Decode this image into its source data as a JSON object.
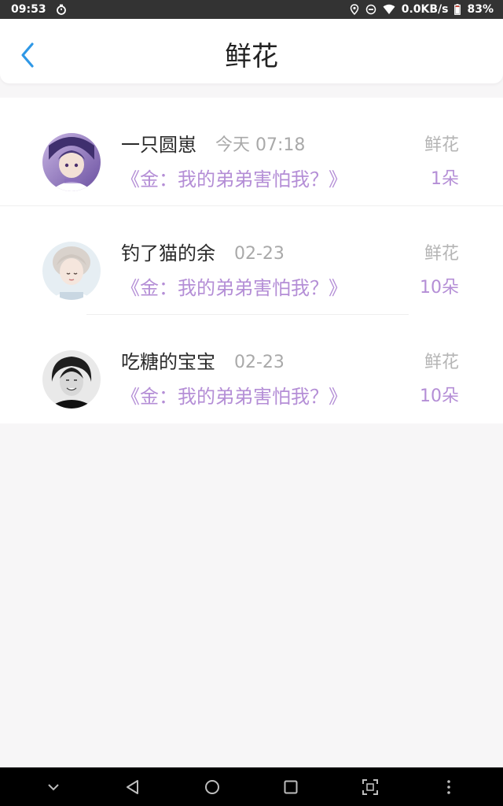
{
  "status_bar": {
    "time": "09:53",
    "network_speed": "0.0KB/s",
    "battery": "83%"
  },
  "header": {
    "title": "鲜花",
    "back_icon": "chevron-left-icon",
    "accent_color": "#2f98e6"
  },
  "colors": {
    "accent_purple": "#b48ed6",
    "muted_gray": "#a9a9a9",
    "background": "#f7f6f7"
  },
  "records": [
    {
      "user": "一只圆崽",
      "time": "今天 07:18",
      "book": "《金：我的弟弟害怕我？》",
      "gift": "鲜花",
      "count": "1朵"
    },
    {
      "user": "钓了猫的余",
      "time": "02-23",
      "book": "《金：我的弟弟害怕我？》",
      "gift": "鲜花",
      "count": "10朵"
    },
    {
      "user": "吃糖的宝宝",
      "time": "02-23",
      "book": "《金：我的弟弟害怕我？》",
      "gift": "鲜花",
      "count": "10朵"
    }
  ],
  "nav_bar": {
    "icons": [
      "chevron-down-icon",
      "back-triangle-icon",
      "home-circle-icon",
      "recents-square-icon",
      "screenshot-icon",
      "more-dots-icon"
    ]
  }
}
